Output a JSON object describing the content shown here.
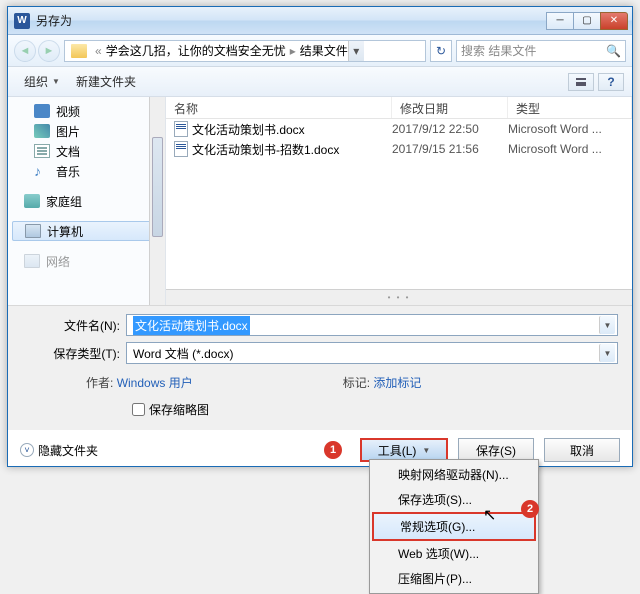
{
  "title": "另存为",
  "breadcrumb": {
    "path1": "学会这几招，让你的文档安全无忧",
    "path2": "结果文件"
  },
  "search_placeholder": "搜索 结果文件",
  "toolbar": {
    "organize": "组织",
    "newfolder": "新建文件夹"
  },
  "sidebar": {
    "video": "视频",
    "picture": "图片",
    "doc": "文档",
    "music": "音乐",
    "homegroup": "家庭组",
    "computer": "计算机",
    "network": "网络"
  },
  "columns": {
    "name": "名称",
    "date": "修改日期",
    "type": "类型"
  },
  "files": [
    {
      "name": "文化活动策划书.docx",
      "date": "2017/9/12 22:50",
      "type": "Microsoft Word ..."
    },
    {
      "name": "文化活动策划书-招数1.docx",
      "date": "2017/9/15 21:56",
      "type": "Microsoft Word ..."
    }
  ],
  "form": {
    "filename_label": "文件名(N):",
    "filename_value": "文化活动策划书.docx",
    "filetype_label": "保存类型(T):",
    "filetype_value": "Word 文档 (*.docx)",
    "author_label": "作者:",
    "author_value": "Windows 用户",
    "tag_label": "标记:",
    "tag_value": "添加标记",
    "thumbnail": "保存缩略图"
  },
  "buttons": {
    "hide": "隐藏文件夹",
    "tools": "工具(L)",
    "save": "保存(S)",
    "cancel": "取消"
  },
  "badges": {
    "one": "1",
    "two": "2"
  },
  "menu": {
    "i1": "映射网络驱动器(N)...",
    "i2": "保存选项(S)...",
    "i3": "常规选项(G)...",
    "i4": "Web 选项(W)...",
    "i5": "压缩图片(P)..."
  }
}
